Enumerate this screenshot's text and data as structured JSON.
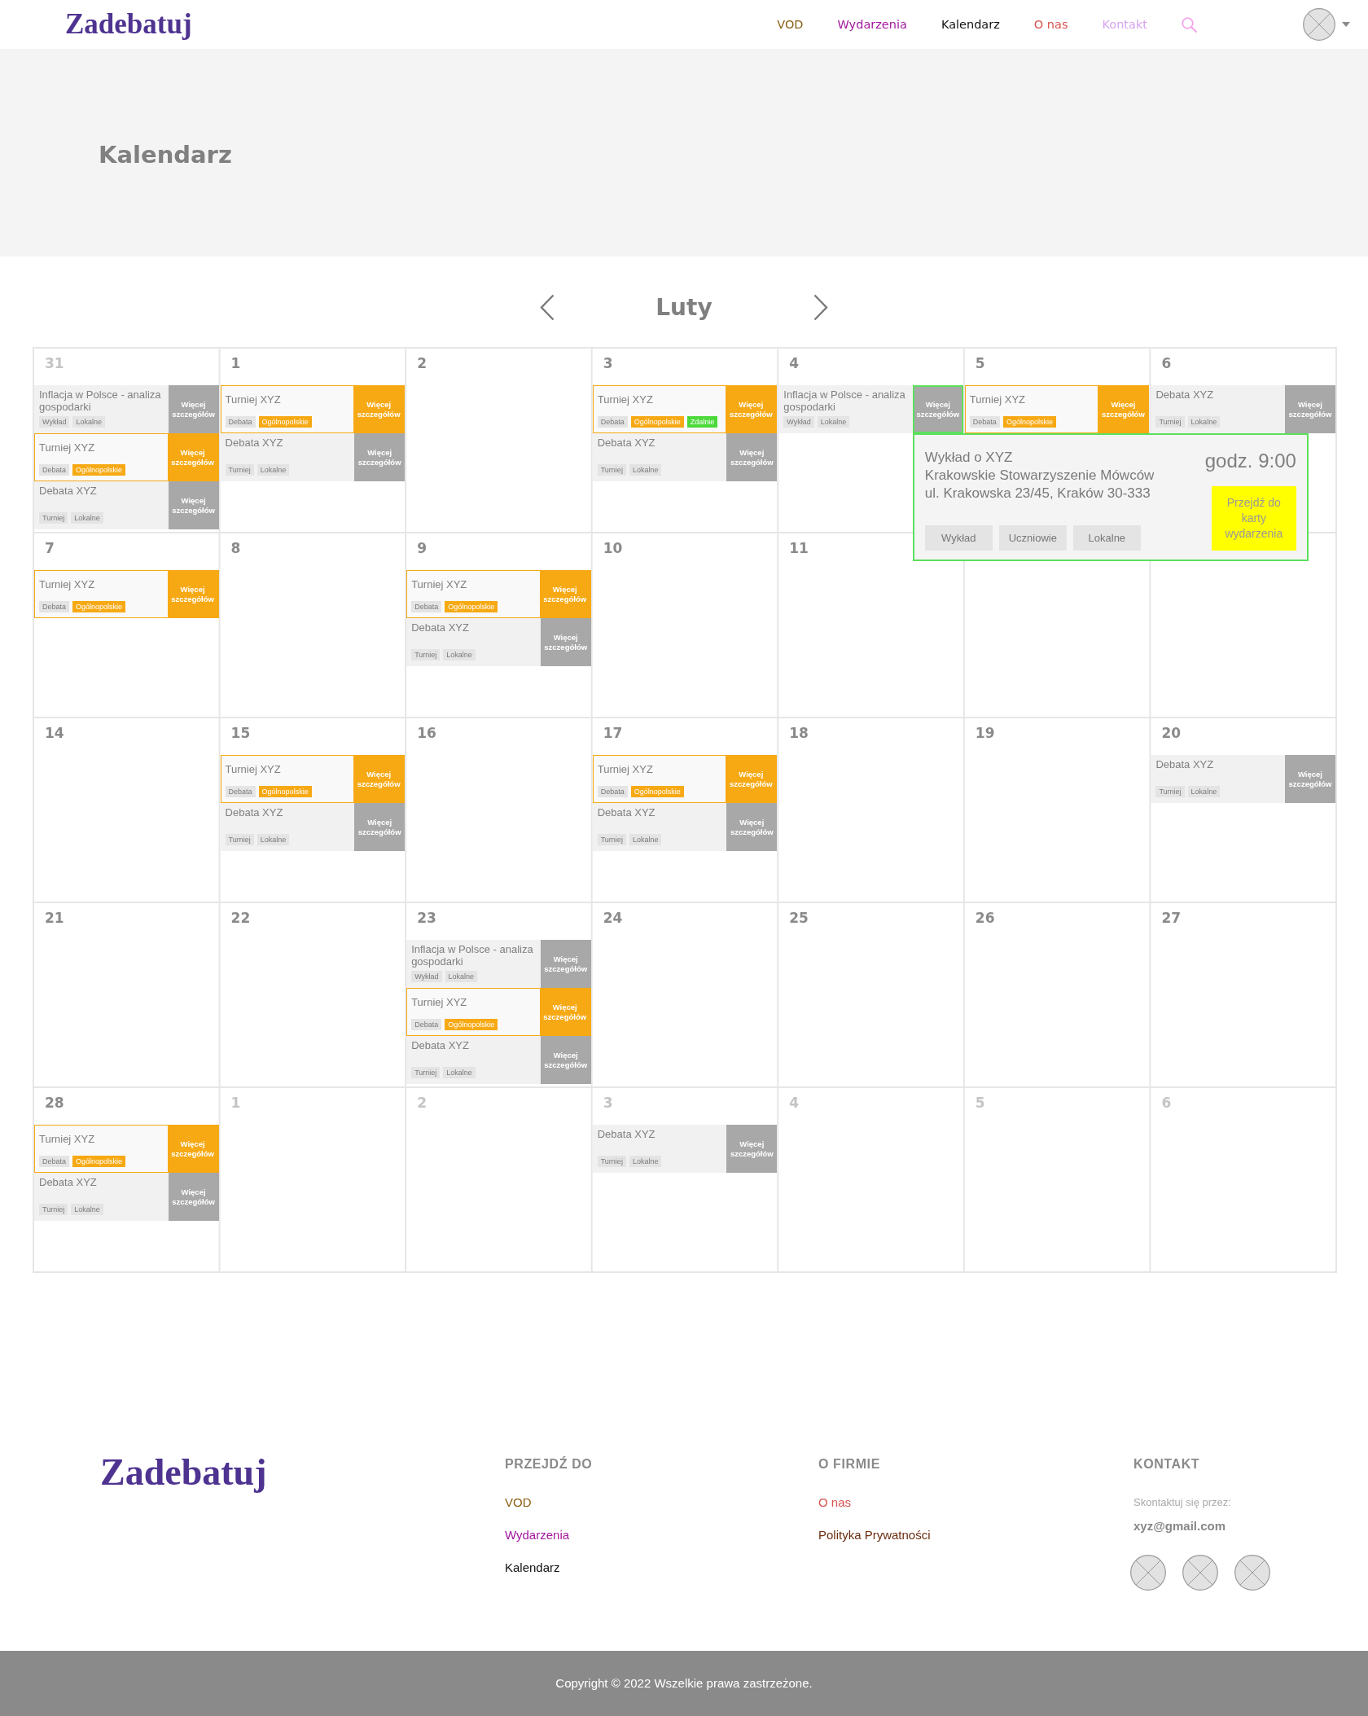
{
  "header": {
    "logo": "Zadebatuj",
    "nav": [
      {
        "label": "VOD",
        "color": "#8a5f12"
      },
      {
        "label": "Wydarzenia",
        "color": "#a3179e"
      },
      {
        "label": "Kalendarz",
        "color": "#111111"
      },
      {
        "label": "O nas",
        "color": "#d9534f"
      },
      {
        "label": "Kontakt",
        "color": "#d6a4ef"
      }
    ]
  },
  "banner": {
    "title": "Kalendarz"
  },
  "calendar": {
    "month": "Luty",
    "weeks": [
      [
        {
          "day": "31",
          "outside_month": true,
          "events": [
            {
              "kind": "standard",
              "title": "Inflacja w Polsce - analiza gospodarki",
              "tags": [
                {
                  "label": "Wykład",
                  "color": "#e4e4e4"
                },
                {
                  "label": "Lokalne",
                  "color": "#e4e4e4"
                }
              ],
              "button": "Więcej szczegółów",
              "expanded": false
            },
            {
              "kind": "featured",
              "title": "Turniej XYZ",
              "tags": [
                {
                  "label": "Debata",
                  "color": "#e4e4e4"
                },
                {
                  "label": "Ogólnopolskie",
                  "color": "#f7a914"
                }
              ],
              "button": "Więcej szczegółów",
              "expanded": false
            },
            {
              "kind": "standard",
              "title": "Debata XYZ",
              "tags": [
                {
                  "label": "Turniej",
                  "color": "#e4e4e4"
                },
                {
                  "label": "Lokalne",
                  "color": "#e4e4e4"
                }
              ],
              "button": "Więcej szczegółów",
              "expanded": false
            }
          ]
        },
        {
          "day": "1",
          "outside_month": false,
          "events": [
            {
              "kind": "featured",
              "title": "Turniej XYZ",
              "tags": [
                {
                  "label": "Debata",
                  "color": "#e4e4e4"
                },
                {
                  "label": "Ogólnopolskie",
                  "color": "#f7a914"
                }
              ],
              "button": "Więcej szczegółów",
              "expanded": false
            },
            {
              "kind": "standard",
              "title": "Debata XYZ",
              "tags": [
                {
                  "label": "Turniej",
                  "color": "#e4e4e4"
                },
                {
                  "label": "Lokalne",
                  "color": "#e4e4e4"
                }
              ],
              "button": "Więcej szczegółów",
              "expanded": false
            }
          ]
        },
        {
          "day": "2",
          "outside_month": false
        },
        {
          "day": "3",
          "outside_month": false,
          "events": [
            {
              "kind": "featured",
              "title": "Turniej XYZ",
              "tags": [
                {
                  "label": "Debata",
                  "color": "#e4e4e4"
                },
                {
                  "label": "Ogólnopolskie",
                  "color": "#f7a914"
                },
                {
                  "label": "Zdalnie",
                  "color": "#4cd93a"
                }
              ],
              "button": "Więcej szczegółów",
              "expanded": false
            },
            {
              "kind": "standard",
              "title": "Debata XYZ",
              "tags": [
                {
                  "label": "Turniej",
                  "color": "#e4e4e4"
                },
                {
                  "label": "Lokalne",
                  "color": "#e4e4e4"
                }
              ],
              "button": "Więcej szczegółów",
              "expanded": false
            }
          ]
        },
        {
          "day": "4",
          "outside_month": false,
          "events": [
            {
              "kind": "standard",
              "title": "Inflacja w Polsce - analiza gospodarki",
              "tags": [
                {
                  "label": "Wykład",
                  "color": "#e4e4e4"
                },
                {
                  "label": "Lokalne",
                  "color": "#e4e4e4"
                }
              ],
              "button": "Więcej szczegółów",
              "expanded": true,
              "popup": {
                "title": "Wykład o XYZ",
                "organizer": "Krakowskie Stowarzyszenie Mówców",
                "address": "ul. Krakowska 23/45, Kraków 30-333",
                "time": "godz. 9:00",
                "tags": [
                  "Wykład",
                  "Uczniowie",
                  "Lokalne"
                ],
                "action": "Przejdź do karty wydarzenia"
              }
            }
          ]
        },
        {
          "day": "5",
          "outside_month": false,
          "events": [
            {
              "kind": "featured",
              "title": "Turniej XYZ",
              "tags": [
                {
                  "label": "Debata",
                  "color": "#e4e4e4"
                },
                {
                  "label": "Ogólnopolskie",
                  "color": "#f7a914"
                }
              ],
              "button": "Więcej szczegółów",
              "expanded": false
            }
          ]
        },
        {
          "day": "6",
          "outside_month": false,
          "events": [
            {
              "kind": "standard",
              "title": "Debata XYZ",
              "tags": [
                {
                  "label": "Turniej",
                  "color": "#e4e4e4"
                },
                {
                  "label": "Lokalne",
                  "color": "#e4e4e4"
                }
              ],
              "button": "Więcej szczegółów",
              "expanded": false
            }
          ]
        }
      ],
      [
        {
          "day": "7",
          "outside_month": false,
          "events": [
            {
              "kind": "featured",
              "title": "Turniej XYZ",
              "tags": [
                {
                  "label": "Debata",
                  "color": "#e4e4e4"
                },
                {
                  "label": "Ogólnopolskie",
                  "color": "#f7a914"
                }
              ],
              "button": "Więcej szczegółów",
              "expanded": false
            }
          ]
        },
        {
          "day": "8",
          "outside_month": false
        },
        {
          "day": "9",
          "outside_month": false,
          "events": [
            {
              "kind": "featured",
              "title": "Turniej XYZ",
              "tags": [
                {
                  "label": "Debata",
                  "color": "#e4e4e4"
                },
                {
                  "label": "Ogólnopolskie",
                  "color": "#f7a914"
                }
              ],
              "button": "Więcej szczegółów",
              "expanded": false
            },
            {
              "kind": "standard",
              "title": "Debata XYZ",
              "tags": [
                {
                  "label": "Turniej",
                  "color": "#e4e4e4"
                },
                {
                  "label": "Lokalne",
                  "color": "#e4e4e4"
                }
              ],
              "button": "Więcej szczegółów",
              "expanded": false
            }
          ]
        },
        {
          "day": "10",
          "outside_month": false
        },
        {
          "day": "11",
          "outside_month": false
        }
      ],
      [
        {
          "day": "14",
          "outside_month": false
        },
        {
          "day": "15",
          "outside_month": false,
          "events": [
            {
              "kind": "featured",
              "title": "Turniej XYZ",
              "tags": [
                {
                  "label": "Debata",
                  "color": "#e4e4e4"
                },
                {
                  "label": "Ogólnopolskie",
                  "color": "#f7a914"
                }
              ],
              "button": "Więcej szczegółów",
              "expanded": false
            },
            {
              "kind": "standard",
              "title": "Debata XYZ",
              "tags": [
                {
                  "label": "Turniej",
                  "color": "#e4e4e4"
                },
                {
                  "label": "Lokalne",
                  "color": "#e4e4e4"
                }
              ],
              "button": "Więcej szczegółów",
              "expanded": false
            }
          ]
        },
        {
          "day": "16",
          "outside_month": false
        },
        {
          "day": "17",
          "outside_month": false,
          "events": [
            {
              "kind": "featured",
              "title": "Turniej XYZ",
              "tags": [
                {
                  "label": "Debata",
                  "color": "#e4e4e4"
                },
                {
                  "label": "Ogólnopolskie",
                  "color": "#f7a914"
                }
              ],
              "button": "Więcej szczegółów",
              "expanded": false
            },
            {
              "kind": "standard",
              "title": "Debata XYZ",
              "tags": [
                {
                  "label": "Turniej",
                  "color": "#e4e4e4"
                },
                {
                  "label": "Lokalne",
                  "color": "#e4e4e4"
                }
              ],
              "button": "Więcej szczegółów",
              "expanded": false
            }
          ]
        },
        {
          "day": "18",
          "outside_month": false
        },
        {
          "day": "19",
          "outside_month": false
        },
        {
          "day": "20",
          "outside_month": false,
          "events": [
            {
              "kind": "standard",
              "title": "Debata XYZ",
              "tags": [
                {
                  "label": "Turniej",
                  "color": "#e4e4e4"
                },
                {
                  "label": "Lokalne",
                  "color": "#e4e4e4"
                }
              ],
              "button": "Więcej szczegółów",
              "expanded": false
            }
          ]
        }
      ],
      [
        {
          "day": "21",
          "outside_month": false
        },
        {
          "day": "22",
          "outside_month": false
        },
        {
          "day": "23",
          "outside_month": false,
          "events": [
            {
              "kind": "standard",
              "title": "Inflacja w Polsce - analiza gospodarki",
              "tags": [
                {
                  "label": "Wykład",
                  "color": "#e4e4e4"
                },
                {
                  "label": "Lokalne",
                  "color": "#e4e4e4"
                }
              ],
              "button": "Więcej szczegółów",
              "expanded": false
            },
            {
              "kind": "featured",
              "title": "Turniej XYZ",
              "tags": [
                {
                  "label": "Debata",
                  "color": "#e4e4e4"
                },
                {
                  "label": "Ogólnopolskie",
                  "color": "#f7a914"
                }
              ],
              "button": "Więcej szczegółów",
              "expanded": false
            },
            {
              "kind": "standard",
              "title": "Debata XYZ",
              "tags": [
                {
                  "label": "Turniej",
                  "color": "#e4e4e4"
                },
                {
                  "label": "Lokalne",
                  "color": "#e4e4e4"
                }
              ],
              "button": "Więcej szczegółów",
              "expanded": false
            }
          ]
        },
        {
          "day": "24",
          "outside_month": false
        },
        {
          "day": "25",
          "outside_month": false
        },
        {
          "day": "26",
          "outside_month": false
        },
        {
          "day": "27",
          "outside_month": false
        }
      ],
      [
        {
          "day": "28",
          "outside_month": false,
          "events": [
            {
              "kind": "featured",
              "title": "Turniej XYZ",
              "tags": [
                {
                  "label": "Debata",
                  "color": "#e4e4e4"
                },
                {
                  "label": "Ogólnopolskie",
                  "color": "#f7a914"
                }
              ],
              "button": "Więcej szczegółów",
              "expanded": false
            },
            {
              "kind": "standard",
              "title": "Debata XYZ",
              "tags": [
                {
                  "label": "Turniej",
                  "color": "#e4e4e4"
                },
                {
                  "label": "Lokalne",
                  "color": "#e4e4e4"
                }
              ],
              "button": "Więcej szczegółów",
              "expanded": false
            }
          ]
        },
        {
          "day": "1",
          "outside_month": true
        },
        {
          "day": "2",
          "outside_month": true
        },
        {
          "day": "3",
          "outside_month": true,
          "events": [
            {
              "kind": "standard",
              "title": "Debata XYZ",
              "tags": [
                {
                  "label": "Turniej",
                  "color": "#e4e4e4"
                },
                {
                  "label": "Lokalne",
                  "color": "#e4e4e4"
                }
              ],
              "button": "Więcej szczegółów",
              "expanded": false
            }
          ]
        },
        {
          "day": "4",
          "outside_month": true
        },
        {
          "day": "5",
          "outside_month": true
        },
        {
          "day": "6",
          "outside_month": true
        }
      ]
    ]
  },
  "footer": {
    "logo": "Zadebatuj",
    "columns": [
      {
        "kind": "links",
        "heading": "PRZEJDŹ DO",
        "links": [
          {
            "label": "VOD",
            "color": "#8a5f12"
          },
          {
            "label": "Wydarzenia",
            "color": "#a3179e"
          },
          {
            "label": "Kalendarz",
            "color": "#111111"
          }
        ]
      },
      {
        "kind": "links",
        "heading": "O FIRMIE",
        "links": [
          {
            "label": "O nas",
            "color": "#d9534f"
          },
          {
            "label": "Polityka Prywatności",
            "color": "#6b2d10"
          }
        ]
      },
      {
        "kind": "contact",
        "heading": "KONTAKT",
        "note": "Skontaktuj się przez:",
        "email": "xyz@gmail.com"
      }
    ],
    "copyright": "Copyright © 2022 Wszelkie prawa zastrzeżone."
  }
}
